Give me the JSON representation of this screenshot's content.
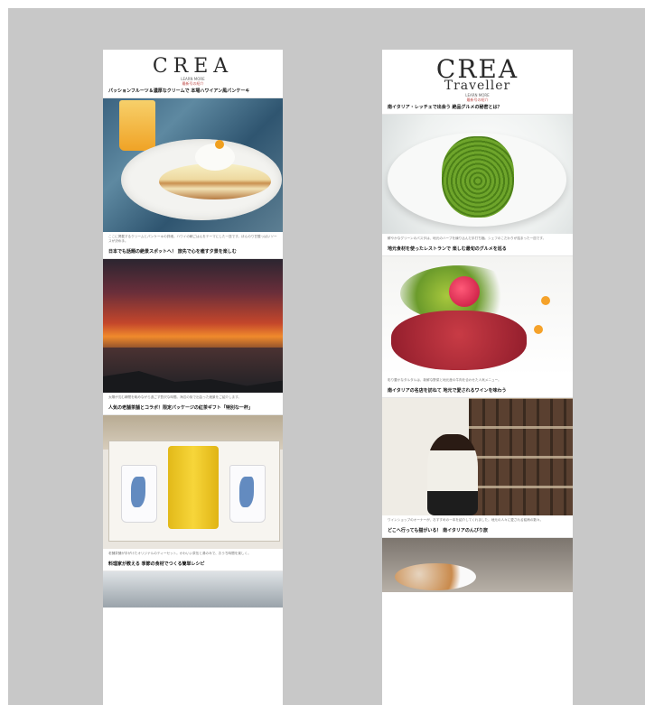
{
  "left": {
    "logo": "CREA",
    "tagline": "LEARN MORE",
    "tagline2": "最新号の紹介",
    "articles": [
      {
        "headline": "パッションフルーツ＆濃厚なクリームで 本場ハワイアン風パンケーキ",
        "caption": "ここに掲載するクリームとパンケーキの詳細。ハワイの朝ごはんをテーマにした一皿です。ほんのり甘酸っぱいソースが決め手。"
      },
      {
        "headline": "日本でも話題の絶景スポットへ！ 旅先で心を癒す夕景を楽しむ",
        "caption": "太陽が沈む瞬間を眺めながら過ごす贅沢な時間。海辺の街で出会った絶景をご紹介します。"
      },
      {
        "headline": "人気の老舗茶舗とコラボ！限定パッケージの紅茶ギフト「特別な一杯」",
        "caption": "老舗茶舗が手がけたオリジナルのティーセット。かわいい茶缶と湯のみで、おうち時間を楽しく。"
      },
      {
        "headline": "料理家が教える 季節の食材でつくる簡単レシピ",
        "caption": ""
      }
    ]
  },
  "right": {
    "logo": "CREA",
    "logo_sub": "Traveller",
    "tagline": "LEARN MORE",
    "tagline2": "最新号の紹介",
    "articles": [
      {
        "headline": "南イタリア・レッチェで出会う 絶品グルメの秘密とは？",
        "caption": "鮮やかなグリーンのパスタは、地元のハーブを練り込んだ手打ち麺。シェフのこだわりが詰まった一皿です。"
      },
      {
        "headline": "地元食材を使ったレストランで 楽しむ最旬のグルメを巡る",
        "caption": "彩り豊かなタルタルは、新鮮な野菜と地元産の牛肉を合わせた人気メニュー。"
      },
      {
        "headline": "南イタリアの名店を訪ねて 地元で愛されるワインを味わう",
        "caption": "ワインショップのオーナーが、おすすめの一本を紹介してくれました。地元の人々に愛される銘柄の数々。"
      },
      {
        "headline": "どこへ行っても猫がいる！ 南イタリアのんびり旅",
        "caption": ""
      }
    ]
  }
}
